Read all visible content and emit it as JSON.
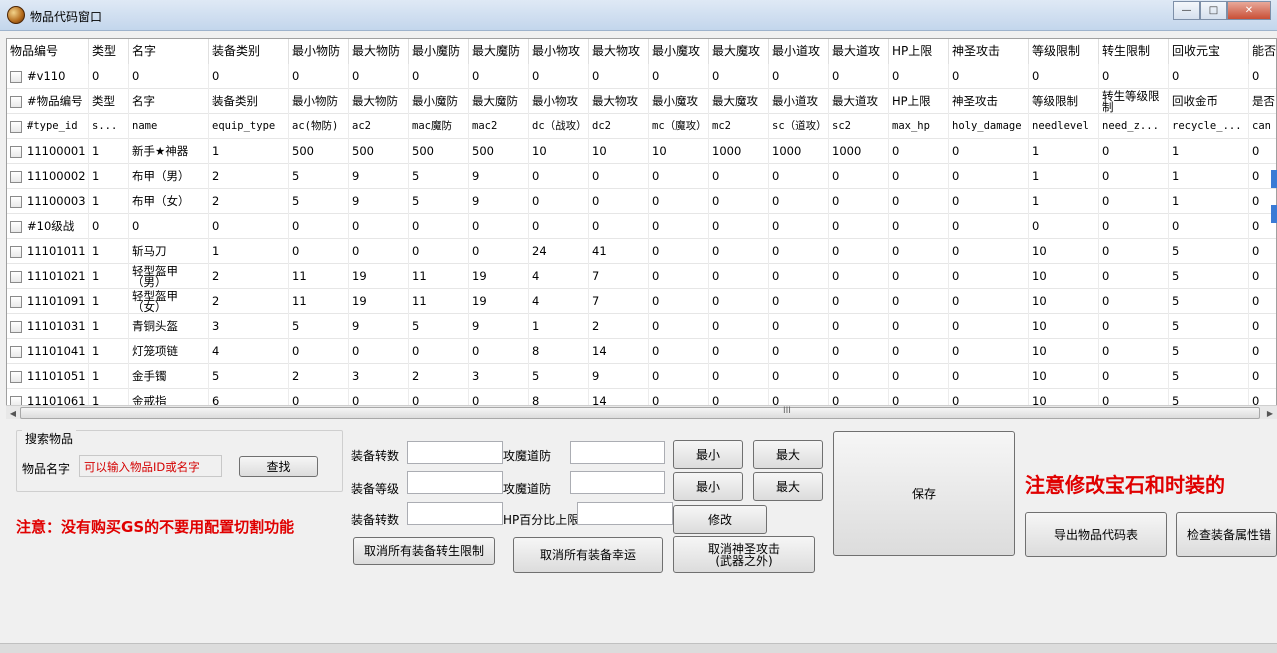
{
  "window": {
    "title": "物品代码窗口"
  },
  "columns": [
    {
      "key": "id",
      "label": "物品编号",
      "w": 82
    },
    {
      "key": "type",
      "label": "类型",
      "w": 40
    },
    {
      "key": "name",
      "label": "名字",
      "w": 80
    },
    {
      "key": "equip",
      "label": "装备类别",
      "w": 80
    },
    {
      "key": "ac",
      "label": "最小物防",
      "w": 60
    },
    {
      "key": "ac2",
      "label": "最大物防",
      "w": 60
    },
    {
      "key": "mac",
      "label": "最小魔防",
      "w": 60
    },
    {
      "key": "mac2",
      "label": "最大魔防",
      "w": 60
    },
    {
      "key": "dc",
      "label": "最小物攻",
      "w": 60
    },
    {
      "key": "dc2",
      "label": "最大物攻",
      "w": 60
    },
    {
      "key": "mc",
      "label": "最小魔攻",
      "w": 60
    },
    {
      "key": "mc2",
      "label": "最大魔攻",
      "w": 60
    },
    {
      "key": "sc",
      "label": "最小道攻",
      "w": 60
    },
    {
      "key": "sc2",
      "label": "最大道攻",
      "w": 60
    },
    {
      "key": "hp",
      "label": "HP上限",
      "w": 60
    },
    {
      "key": "holy",
      "label": "神圣攻击",
      "w": 80
    },
    {
      "key": "lvl",
      "label": "等级限制",
      "w": 70
    },
    {
      "key": "reborn",
      "label": "转生限制",
      "w": 70
    },
    {
      "key": "recycle",
      "label": "回收元宝",
      "w": 80
    },
    {
      "key": "can",
      "label": "能否",
      "w": 40
    }
  ],
  "rows": [
    [
      "#v110",
      "0",
      "0",
      "0",
      "0",
      "0",
      "0",
      "0",
      "0",
      "0",
      "0",
      "0",
      "0",
      "0",
      "0",
      "0",
      "0",
      "0",
      "0",
      "0"
    ],
    [
      "#物品编号",
      "类型",
      "名字",
      "装备类别",
      "最小物防",
      "最大物防",
      "最小魔防",
      "最大魔防",
      "最小物攻",
      "最大物攻",
      "最小魔攻",
      "最大魔攻",
      "最小道攻",
      "最大道攻",
      "HP上限",
      "神圣攻击",
      "等级限制",
      "转生等级限制",
      "回收金币",
      "是否"
    ],
    [
      "#type_id",
      "s...",
      "name",
      "equip_type",
      "ac(物防)",
      "ac2",
      "mac魔防",
      "mac2",
      "dc（战攻）",
      "dc2",
      "mc（魔攻）",
      "mc2",
      "sc（道攻）",
      "sc2",
      "max_hp",
      "holy_damage",
      "needlevel",
      "need_z...",
      "recycle_...",
      "can"
    ],
    [
      "11100001",
      "1",
      "新手★神器",
      "1",
      "500",
      "500",
      "500",
      "500",
      "10",
      "10",
      "10",
      "1000",
      "1000",
      "1000",
      "0",
      "0",
      "1",
      "0",
      "1",
      "0"
    ],
    [
      "11100002",
      "1",
      "布甲（男）",
      "2",
      "5",
      "9",
      "5",
      "9",
      "0",
      "0",
      "0",
      "0",
      "0",
      "0",
      "0",
      "0",
      "1",
      "0",
      "1",
      "0"
    ],
    [
      "11100003",
      "1",
      "布甲（女）",
      "2",
      "5",
      "9",
      "5",
      "9",
      "0",
      "0",
      "0",
      "0",
      "0",
      "0",
      "0",
      "0",
      "1",
      "0",
      "1",
      "0"
    ],
    [
      "#10级战",
      "0",
      "0",
      "0",
      "0",
      "0",
      "0",
      "0",
      "0",
      "0",
      "0",
      "0",
      "0",
      "0",
      "0",
      "0",
      "0",
      "0",
      "0",
      "0"
    ],
    [
      "11101011",
      "1",
      "斩马刀",
      "1",
      "0",
      "0",
      "0",
      "0",
      "24",
      "41",
      "0",
      "0",
      "0",
      "0",
      "0",
      "0",
      "10",
      "0",
      "5",
      "0"
    ],
    [
      "11101021",
      "1",
      "轻型盔甲（男）",
      "2",
      "11",
      "19",
      "11",
      "19",
      "4",
      "7",
      "0",
      "0",
      "0",
      "0",
      "0",
      "0",
      "10",
      "0",
      "5",
      "0"
    ],
    [
      "11101091",
      "1",
      "轻型盔甲（女）",
      "2",
      "11",
      "19",
      "11",
      "19",
      "4",
      "7",
      "0",
      "0",
      "0",
      "0",
      "0",
      "0",
      "10",
      "0",
      "5",
      "0"
    ],
    [
      "11101031",
      "1",
      "青铜头盔",
      "3",
      "5",
      "9",
      "5",
      "9",
      "1",
      "2",
      "0",
      "0",
      "0",
      "0",
      "0",
      "0",
      "10",
      "0",
      "5",
      "0"
    ],
    [
      "11101041",
      "1",
      "灯笼项链",
      "4",
      "0",
      "0",
      "0",
      "0",
      "8",
      "14",
      "0",
      "0",
      "0",
      "0",
      "0",
      "0",
      "10",
      "0",
      "5",
      "0"
    ],
    [
      "11101051",
      "1",
      "金手镯",
      "5",
      "2",
      "3",
      "2",
      "3",
      "5",
      "9",
      "0",
      "0",
      "0",
      "0",
      "0",
      "0",
      "10",
      "0",
      "5",
      "0"
    ],
    [
      "11101061",
      "1",
      "金戒指",
      "6",
      "0",
      "0",
      "0",
      "0",
      "8",
      "14",
      "0",
      "0",
      "0",
      "0",
      "0",
      "0",
      "10",
      "0",
      "5",
      "0"
    ]
  ],
  "scroll_grip": "III",
  "search": {
    "group_title": "搜索物品",
    "name_label": "物品名字",
    "placeholder": "可以输入物品ID或名字",
    "find_button": "查找"
  },
  "edit": {
    "label_reborn": "装备转数",
    "label_level": "装备等级",
    "label_reborn2": "装备转数",
    "label_atk_def1": "攻魔道防",
    "label_atk_def2": "攻魔道防",
    "label_hp_pct": "HP百分比上限",
    "min_button": "最小",
    "max_button": "最大",
    "min_button2": "最小",
    "max_button2": "最大",
    "modify_button": "修改",
    "cancel_reborn_button": "取消所有装备转生限制",
    "cancel_luck_button": "取消所有装备幸运",
    "cancel_holy_button_line1": "取消神圣攻击",
    "cancel_holy_button_line2": "(武器之外)",
    "save_button": "保存"
  },
  "notices": {
    "gs_warning": "注意：没有购买GS的不要用配置切割功能",
    "gem_warning": "注意修改宝石和时装的"
  },
  "actions": {
    "export_button": "导出物品代码表",
    "check_button": "检查装备属性错"
  }
}
